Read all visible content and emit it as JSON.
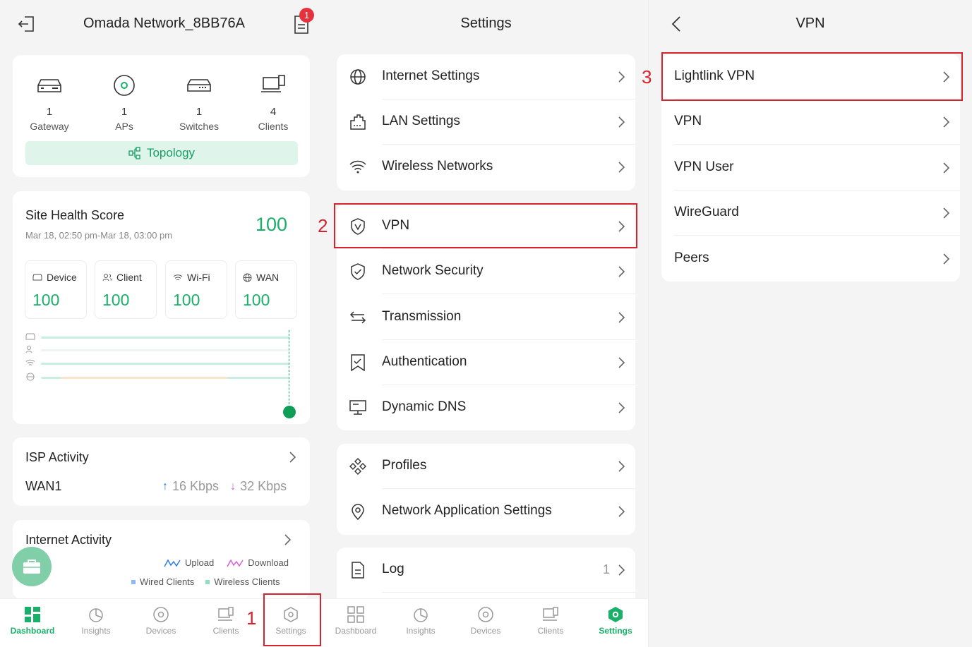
{
  "panel1": {
    "title": "Omada Network_8BB76A",
    "notification_badge": "1",
    "devices": [
      {
        "count": "1",
        "label": "Gateway",
        "icon": "gateway-icon"
      },
      {
        "count": "1",
        "label": "APs",
        "icon": "ap-icon"
      },
      {
        "count": "1",
        "label": "Switches",
        "icon": "switch-icon"
      },
      {
        "count": "4",
        "label": "Clients",
        "icon": "clients-icon"
      }
    ],
    "topology_label": "Topology",
    "health": {
      "title": "Site Health Score",
      "score": "100",
      "time_range": "Mar 18, 02:50 pm-Mar 18, 03:00 pm",
      "scores": [
        {
          "label": "Device",
          "value": "100"
        },
        {
          "label": "Client",
          "value": "100"
        },
        {
          "label": "Wi-Fi",
          "value": "100"
        },
        {
          "label": "WAN",
          "value": "100"
        }
      ]
    },
    "isp": {
      "title": "ISP Activity",
      "wan": "WAN1",
      "up": "16 Kbps",
      "down": "32 Kbps"
    },
    "internet": {
      "title": "Internet Activity",
      "legend_upload": "Upload",
      "legend_download": "Download",
      "legend_wired": "Wired Clients",
      "legend_wireless": "Wireless Clients"
    }
  },
  "panel2": {
    "title": "Settings",
    "group1": [
      "Internet Settings",
      "LAN Settings",
      "Wireless Networks"
    ],
    "group2": [
      "VPN",
      "Network Security",
      "Transmission",
      "Authentication",
      "Dynamic DNS"
    ],
    "group3": [
      "Profiles",
      "Network Application Settings"
    ],
    "log_label": "Log",
    "log_count": "1"
  },
  "panel3": {
    "title": "VPN",
    "items": [
      "Lightlink VPN",
      "VPN",
      "VPN User",
      "WireGuard",
      "Peers"
    ]
  },
  "nav": [
    "Dashboard",
    "Insights",
    "Devices",
    "Clients",
    "Settings"
  ],
  "annotations": [
    "1",
    "2",
    "3"
  ],
  "colors": {
    "accent": "#1ab06a",
    "highlight": "#d6232d"
  }
}
